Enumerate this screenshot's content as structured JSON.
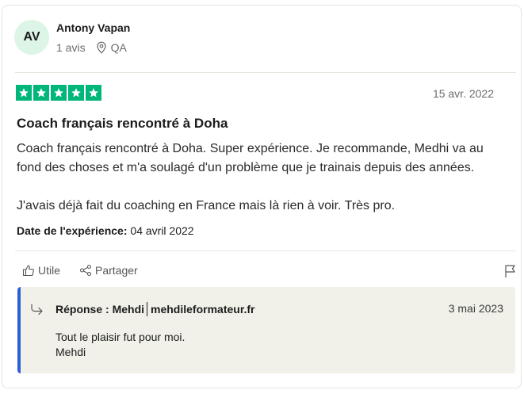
{
  "reviewer": {
    "initials": "AV",
    "name": "Antony Vapan",
    "reviews_count": "1 avis",
    "country": "QA"
  },
  "review": {
    "rating": 5,
    "date": "15 avr. 2022",
    "title": "Coach français rencontré à Doha",
    "paragraphs": [
      "Coach français rencontré à Doha. Super expérience. Je recommande, Medhi va au fond des choses et m'a soulagé d'un problème que je trainais depuis des années.",
      "J'avais déjà fait du coaching en France mais là rien à voir. Très pro."
    ],
    "experience_label": "Date de l'expérience:",
    "experience_date": "04 avril 2022"
  },
  "actions": {
    "useful_label": "Utile",
    "share_label": "Partager"
  },
  "reply": {
    "label": "Réponse : Mehdi",
    "company": "mehdileformateur.fr",
    "date": "3 mai 2023",
    "lines": [
      "Tout le plaisir fut pour moi.",
      "Mehdi"
    ]
  },
  "colors": {
    "star_green": "#00b67a",
    "avatar_bg": "#dcf5e7",
    "reply_accent": "#2b5fd9",
    "reply_bg": "#f1f1ea"
  },
  "icons": [
    "star-icon",
    "location-pin-icon",
    "thumbs-up-icon",
    "share-icon",
    "flag-icon",
    "reply-arrow-icon"
  ]
}
